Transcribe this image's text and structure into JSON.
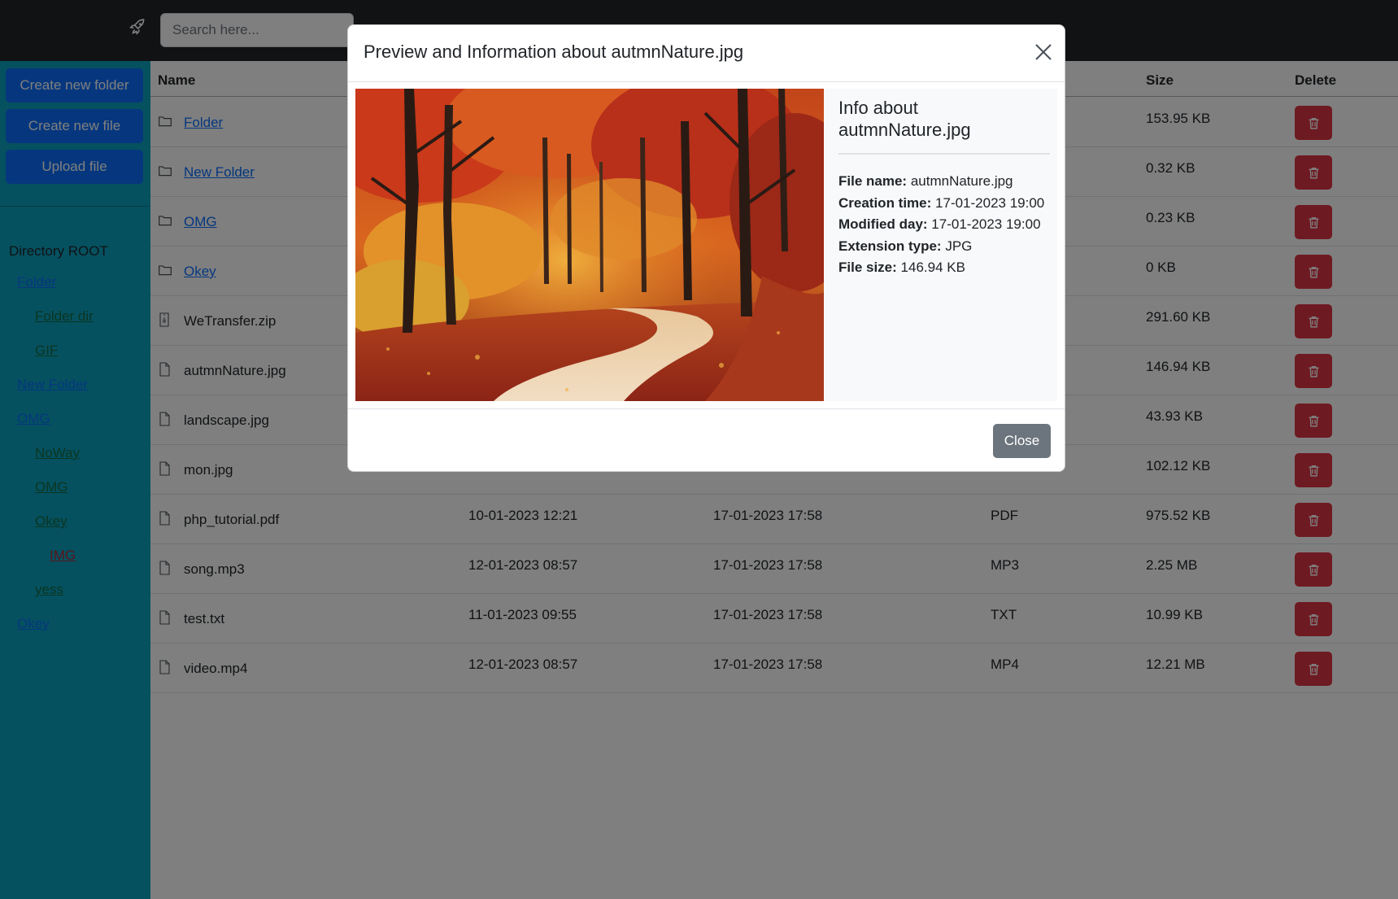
{
  "navbar": {
    "icon": "rocket-icon",
    "search_placeholder": "Search here..."
  },
  "sidebar": {
    "buttons": [
      "Create new folder",
      "Create new file",
      "Upload file"
    ],
    "directory_root": "Directory ROOT",
    "tree": [
      {
        "label": "Folder",
        "level": 1,
        "color": "blue"
      },
      {
        "label": "Folder dir",
        "level": 2,
        "color": "green"
      },
      {
        "label": "GIF",
        "level": 2,
        "color": "green"
      },
      {
        "label": "New Folder",
        "level": 1,
        "color": "blue"
      },
      {
        "label": "OMG",
        "level": 1,
        "color": "blue"
      },
      {
        "label": "NoWay",
        "level": 2,
        "color": "green"
      },
      {
        "label": "OMG",
        "level": 2,
        "color": "green"
      },
      {
        "label": "Okey",
        "level": 2,
        "color": "green"
      },
      {
        "label": "IMG",
        "level": 3,
        "color": "red"
      },
      {
        "label": "yess",
        "level": 2,
        "color": "green"
      },
      {
        "label": "Okey",
        "level": 1,
        "color": "blue"
      }
    ]
  },
  "table": {
    "headers": {
      "name": "Name",
      "size": "Size",
      "delete": "Delete"
    },
    "rows": [
      {
        "name": "Folder",
        "type": "folder",
        "created": "",
        "modified": "",
        "ext": "",
        "size": "153.95 KB"
      },
      {
        "name": "New Folder",
        "type": "folder",
        "created": "",
        "modified": "",
        "ext": "",
        "size": "0.32 KB"
      },
      {
        "name": "OMG",
        "type": "folder",
        "created": "",
        "modified": "",
        "ext": "",
        "size": "0.23 KB"
      },
      {
        "name": "Okey",
        "type": "folder",
        "created": "",
        "modified": "",
        "ext": "",
        "size": "0 KB"
      },
      {
        "name": "WeTransfer.zip",
        "type": "zip",
        "created": "",
        "modified": "",
        "ext": "",
        "size": "291.60 KB"
      },
      {
        "name": "autmnNature.jpg",
        "type": "file",
        "created": "",
        "modified": "",
        "ext": "",
        "size": "146.94 KB"
      },
      {
        "name": "landscape.jpg",
        "type": "file",
        "created": "",
        "modified": "",
        "ext": "",
        "size": "43.93 KB"
      },
      {
        "name": "mon.jpg",
        "type": "file",
        "created": "",
        "modified": "",
        "ext": "",
        "size": "102.12 KB"
      },
      {
        "name": "php_tutorial.pdf",
        "type": "file",
        "created": "10-01-2023 12:21",
        "modified": "17-01-2023 17:58",
        "ext": "PDF",
        "size": "975.52 KB"
      },
      {
        "name": "song.mp3",
        "type": "file",
        "created": "12-01-2023 08:57",
        "modified": "17-01-2023 17:58",
        "ext": "MP3",
        "size": "2.25 MB"
      },
      {
        "name": "test.txt",
        "type": "file",
        "created": "11-01-2023 09:55",
        "modified": "17-01-2023 17:58",
        "ext": "TXT",
        "size": "10.99 KB"
      },
      {
        "name": "video.mp4",
        "type": "file",
        "created": "12-01-2023 08:57",
        "modified": "17-01-2023 17:58",
        "ext": "MP4",
        "size": "12.21 MB"
      }
    ]
  },
  "modal": {
    "title": "Preview and Information about autmnNature.jpg",
    "info_title": "Info about autmnNature.jpg",
    "info": [
      {
        "label": "File name:",
        "value": "autmnNature.jpg"
      },
      {
        "label": "Creation time:",
        "value": "17-01-2023 19:00"
      },
      {
        "label": "Modified day:",
        "value": "17-01-2023 19:00"
      },
      {
        "label": "Extension type:",
        "value": "JPG"
      },
      {
        "label": "File size:",
        "value": "146.94 KB"
      }
    ],
    "close_label": "Close"
  },
  "colors": {
    "primary": "#0d6efd",
    "danger": "#dc3545",
    "sidebar": "#0aa2c0",
    "navbar": "#212529",
    "secondary": "#6c757d"
  }
}
